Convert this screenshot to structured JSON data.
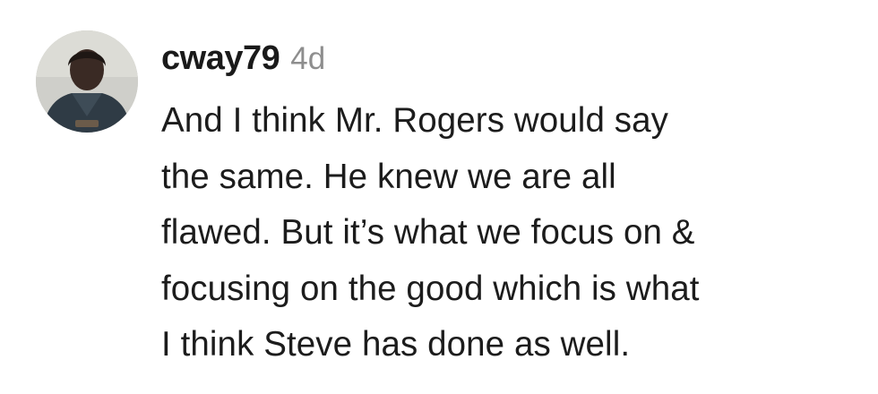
{
  "comment": {
    "username": "cway79",
    "timestamp": "4d",
    "avatar": {
      "icon": "profile-photo",
      "colors": {
        "background": "#cfcfca",
        "clothing": "#2f3b45",
        "skin": "#3a2a24"
      }
    },
    "lines": [
      "And I think Mr. Rogers would say",
      "the same. He knew we are all",
      "flawed. But it’s what we focus on &",
      "focusing on the good which is what",
      "I think Steve has done as well."
    ]
  }
}
